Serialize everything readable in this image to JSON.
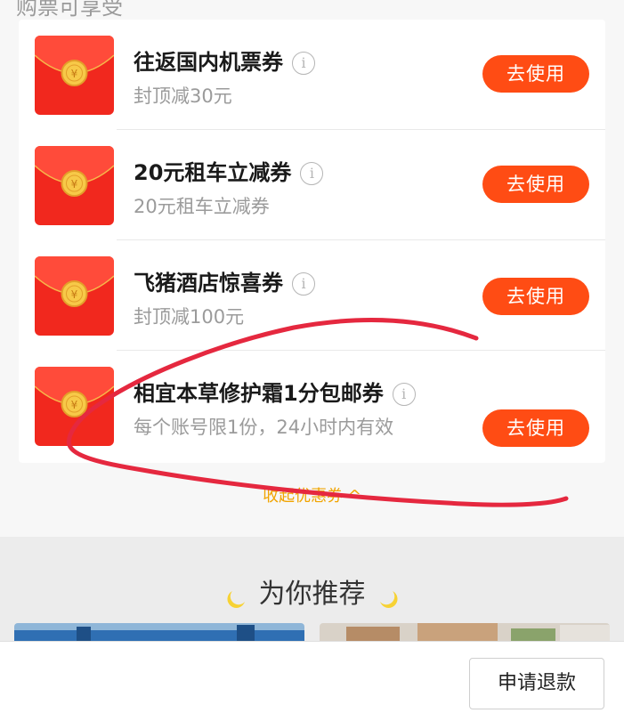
{
  "top_partial_text": "购票可享受",
  "coupons": [
    {
      "title": "往返国内机票券",
      "subtitle": "封顶减30元",
      "button": "去使用"
    },
    {
      "title": "20元租车立减券",
      "subtitle": "20元租车立减券",
      "button": "去使用"
    },
    {
      "title": "飞猪酒店惊喜券",
      "subtitle": "封顶减100元",
      "button": "去使用"
    },
    {
      "title": "相宜本草修护霜1分包邮券",
      "subtitle": "每个账号限1份，24小时内有效",
      "button": "去使用"
    }
  ],
  "info_glyph": "i",
  "envelope_glyph": "¥",
  "collapse_label": "收起优惠券",
  "collapse_arrow": "^",
  "recommend_title": "为你推荐",
  "refund_button": "申请退款",
  "colors": {
    "accent": "#ff4c14",
    "envelope": "#f1281e",
    "coin": "#f7c948",
    "collapse": "#f1a400",
    "annotation": "#e5283f"
  }
}
